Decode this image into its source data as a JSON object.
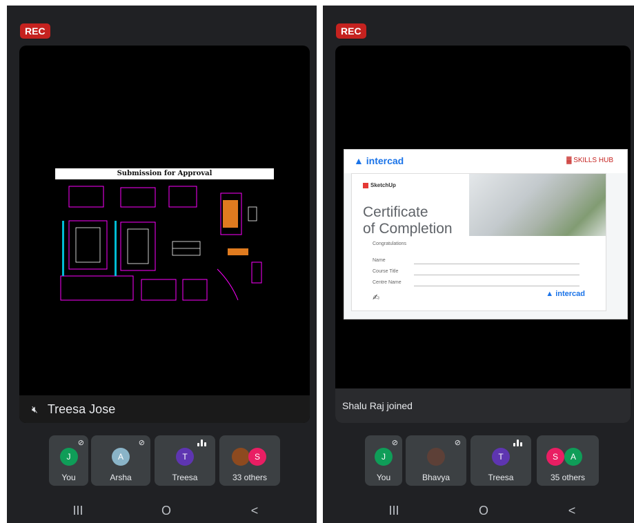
{
  "left": {
    "rec": "REC",
    "speaker_name": "Treesa Jose",
    "shared_title": "Submission for Approval",
    "participants": [
      {
        "label": "You",
        "initial": "J",
        "color": "#0f9d58",
        "muted": true
      },
      {
        "label": "Arsha",
        "initial": "A",
        "color": "#8ab4c8",
        "muted": true
      },
      {
        "label": "Treesa",
        "initial": "T",
        "color": "#5e35b1",
        "speaking": true
      },
      {
        "label": "33 others",
        "initial": "S",
        "color": "#e91e63"
      }
    ]
  },
  "right": {
    "rec": "REC",
    "notice": "Shalu Raj joined",
    "certificate": {
      "brand_left": "intercad",
      "brand_right": "SKILLS HUB",
      "product": "SketchUp",
      "title_line1": "Certificate",
      "title_line2": "of Completion",
      "fields": [
        "Congratulations",
        "Name",
        "Course Title",
        "Centre Name"
      ],
      "footer_brand": "intercad"
    },
    "participants": [
      {
        "label": "You",
        "initial": "J",
        "color": "#0f9d58",
        "muted": true
      },
      {
        "label": "Bhavya",
        "initial": "",
        "color": "#5d4037",
        "muted": true
      },
      {
        "label": "Treesa",
        "initial": "T",
        "color": "#5e35b1",
        "speaking": true
      },
      {
        "label": "35 others",
        "initial": "S",
        "initial2": "A",
        "color": "#e91e63",
        "color2": "#0f9d58"
      }
    ]
  },
  "nav": {
    "recents": "III",
    "home": "O",
    "back": "<"
  }
}
